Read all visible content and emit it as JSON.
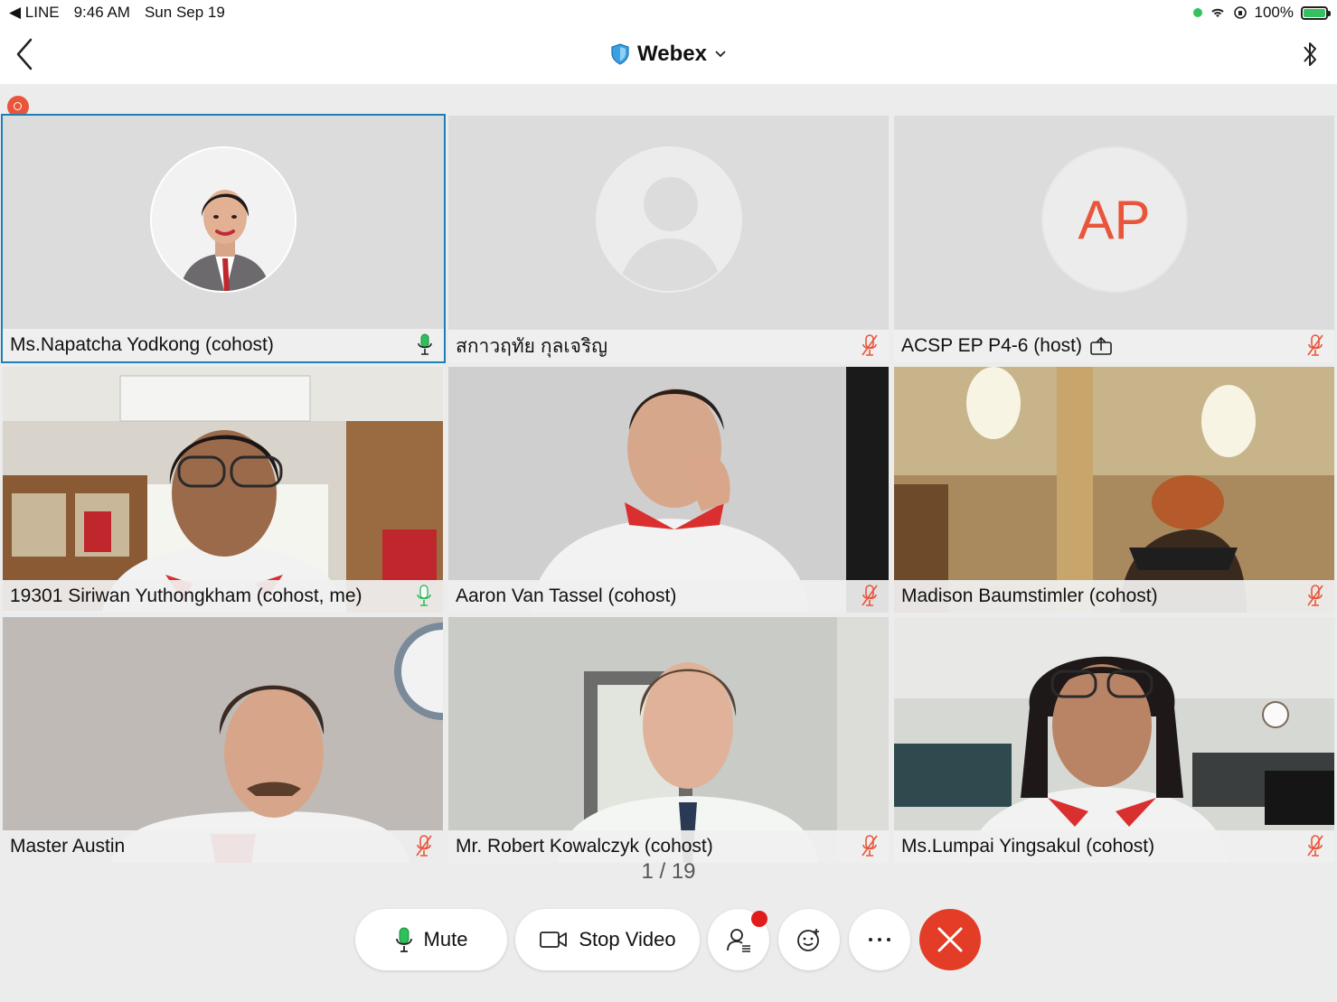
{
  "status_bar": {
    "back_app": "LINE",
    "time": "9:46 AM",
    "date": "Sun Sep 19",
    "battery": "100%"
  },
  "header": {
    "title": "Webex"
  },
  "tiles": [
    {
      "name": "Ms.Napatcha Yodkong (cohost)",
      "avatar": "photo",
      "mic": "active"
    },
    {
      "name": "สกาวฤทัย กุลเจริญ",
      "avatar": "placeholder",
      "mic": "muted"
    },
    {
      "name": "ACSP EP P4-6 (host)",
      "avatar_initials": "AP",
      "mic": "muted",
      "sharing": true
    },
    {
      "name": "19301 Siriwan Yuthongkham (cohost, me)",
      "mic": "active"
    },
    {
      "name": "Aaron Van Tassel (cohost)",
      "mic": "muted"
    },
    {
      "name": "Madison Baumstimler (cohost)",
      "mic": "muted"
    },
    {
      "name": "Master Austin",
      "mic": "muted"
    },
    {
      "name": "Mr. Robert Kowalczyk (cohost)",
      "mic": "muted"
    },
    {
      "name": "Ms.Lumpai Yingsakul (cohost)",
      "mic": "muted"
    }
  ],
  "pager": "1 / 19",
  "controls": {
    "mute_label": "Mute",
    "stop_video_label": "Stop Video"
  },
  "colors": {
    "accent_blue": "#1d7fb6",
    "muted_red": "#e9553b",
    "mic_green": "#2fbf5b",
    "end_call": "#e33d28"
  }
}
